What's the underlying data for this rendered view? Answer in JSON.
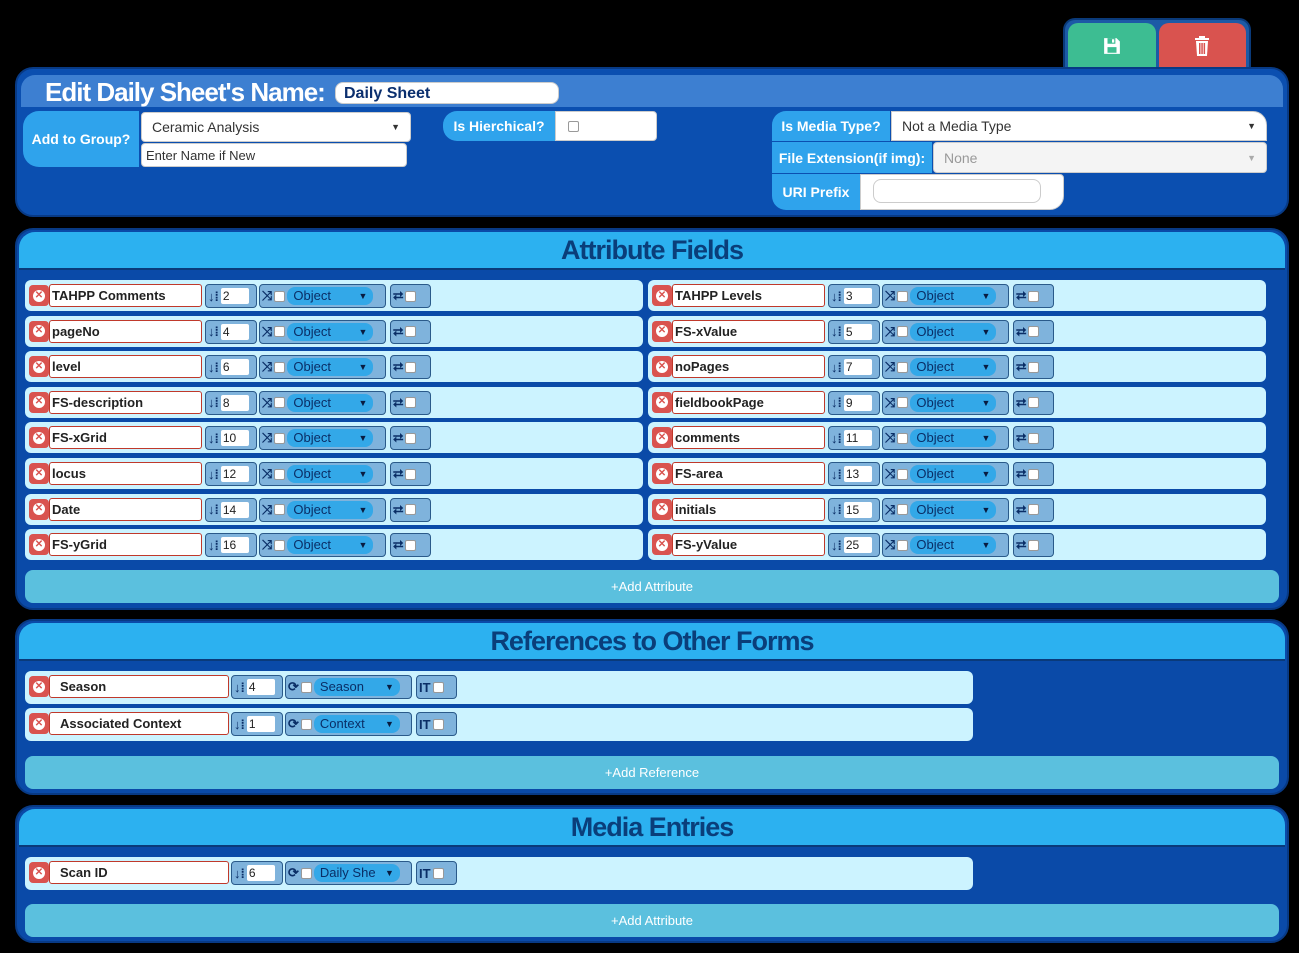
{
  "header": {
    "title": "Edit Daily Sheet's Name:",
    "name_value": "Daily Sheet",
    "add_to_group_label": "Add to Group?",
    "group_selected": "Ceramic Analysis",
    "new_group_placeholder": "Enter Name if New",
    "hierarchical_label": "Is Hierchical?",
    "media_type_label": "Is Media Type?",
    "media_type_selected": "Not a Media Type",
    "file_ext_label": "File Extension(if img):",
    "file_ext_selected": "None",
    "uri_prefix_label": "URI Prefix",
    "uri_prefix_value": ""
  },
  "toolbar": {
    "save_icon": "save-icon",
    "delete_icon": "trash-icon"
  },
  "attributes": {
    "title": "Attribute Fields",
    "add_label": "+Add Attribute",
    "left": [
      {
        "name": "TAHPP Comments",
        "order": "2",
        "type": "Object"
      },
      {
        "name": "pageNo",
        "order": "4",
        "type": "Object"
      },
      {
        "name": "level",
        "order": "6",
        "type": "Object"
      },
      {
        "name": "FS-description",
        "order": "8",
        "type": "Object"
      },
      {
        "name": "FS-xGrid",
        "order": "10",
        "type": "Object"
      },
      {
        "name": "locus",
        "order": "12",
        "type": "Object"
      },
      {
        "name": "Date",
        "order": "14",
        "type": "Object"
      },
      {
        "name": "FS-yGrid",
        "order": "16",
        "type": "Object"
      }
    ],
    "right": [
      {
        "name": "TAHPP Levels",
        "order": "3",
        "type": "Object"
      },
      {
        "name": "FS-xValue",
        "order": "5",
        "type": "Object"
      },
      {
        "name": "noPages",
        "order": "7",
        "type": "Object"
      },
      {
        "name": "fieldbookPage",
        "order": "9",
        "type": "Object"
      },
      {
        "name": "comments",
        "order": "11",
        "type": "Object"
      },
      {
        "name": "FS-area",
        "order": "13",
        "type": "Object"
      },
      {
        "name": "initials",
        "order": "15",
        "type": "Object"
      },
      {
        "name": "FS-yValue",
        "order": "25",
        "type": "Object"
      }
    ]
  },
  "references": {
    "title": "References to Other Forms",
    "add_label": "+Add Reference",
    "items": [
      {
        "name": "Season",
        "order": "4",
        "form": "Season"
      },
      {
        "name": "Associated Context",
        "order": "1",
        "form": "Context"
      }
    ]
  },
  "media": {
    "title": "Media Entries",
    "add_label": "+Add Attribute",
    "items": [
      {
        "name": "Scan ID",
        "order": "6",
        "form": "Daily She"
      }
    ]
  },
  "colors": {
    "panel": "#0a4aa8",
    "section_header": "#2cb1f0",
    "row": "#ccf3ff",
    "save": "#3dbd92",
    "delete": "#d9534f",
    "add": "#5bc0de"
  }
}
